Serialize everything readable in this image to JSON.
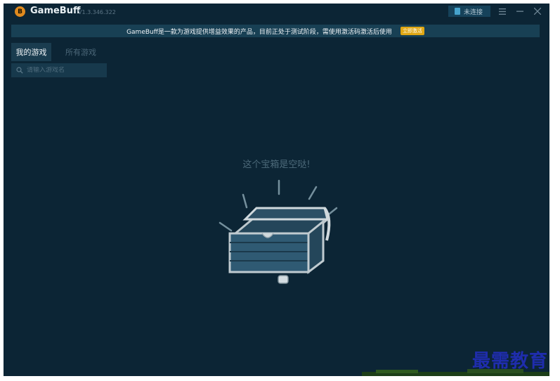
{
  "app": {
    "title": "GameBuff",
    "version": "V1.3.346.322",
    "logo_letter": "B"
  },
  "titlebar": {
    "connection_label": "未连接",
    "icons": [
      "connection-icon",
      "menu-icon",
      "minimize-icon",
      "close-icon"
    ]
  },
  "banner": {
    "text": "GameBuff是一款为游戏提供增益效果的产品，目前正处于测试阶段，需使用激活码激活后使用",
    "activate_label": "立即激活"
  },
  "tabs": [
    {
      "label": "我的游戏",
      "active": true
    },
    {
      "label": "所有游戏",
      "active": false
    }
  ],
  "search": {
    "placeholder": "请输入游戏名"
  },
  "empty_state": {
    "message": "这个宝箱是空哒!",
    "illustration": "empty-treasure-chest"
  },
  "watermark": {
    "text": "最需教育"
  },
  "colors": {
    "background": "#0c2535",
    "banner": "#184054",
    "accent": "#e0a713",
    "logo": "#e08a1e",
    "watermark": "#1f2dad"
  }
}
